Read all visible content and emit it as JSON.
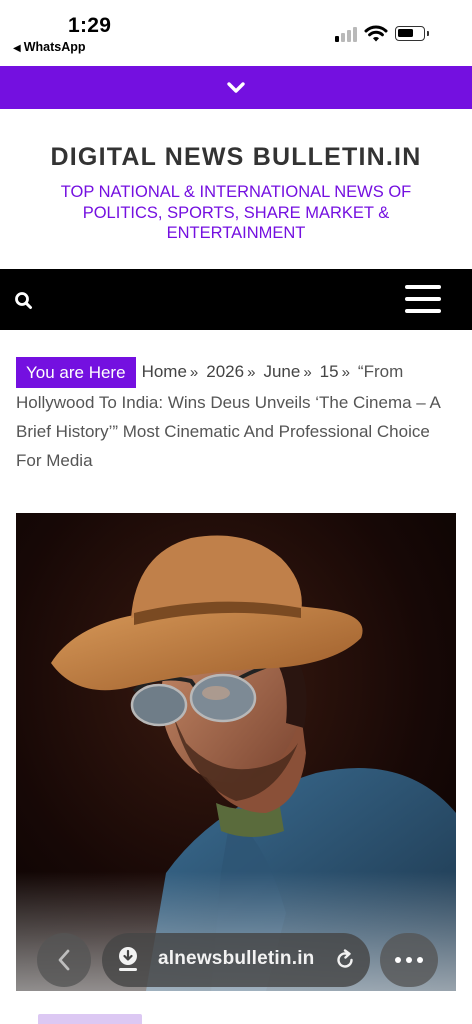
{
  "status_bar": {
    "time": "1:29",
    "back_app": "WhatsApp"
  },
  "site": {
    "title": "DIGITAL NEWS BULLETIN.IN",
    "tagline": "TOP NATIONAL & INTERNATIONAL NEWS OF POLITICS, SPORTS, SHARE MARKET & ENTERTAINMENT"
  },
  "colors": {
    "accent": "#7410e0",
    "nav_background": "#000000",
    "title_text": "#333333"
  },
  "icons": {
    "toggle": "chevron-down-icon",
    "search": "search-icon",
    "menu": "hamburger-menu-icon"
  },
  "breadcrumb": {
    "label": "You are Here",
    "items": [
      "Home",
      "2026",
      "June",
      "15"
    ],
    "separator": "»",
    "current": "“From Hollywood To India: Wins Deus Unveils ‘The Cinema – A Brief History’” Most Cinematic And Professional Choice For Media"
  },
  "browser": {
    "url": "alnewsbulletin.in"
  }
}
